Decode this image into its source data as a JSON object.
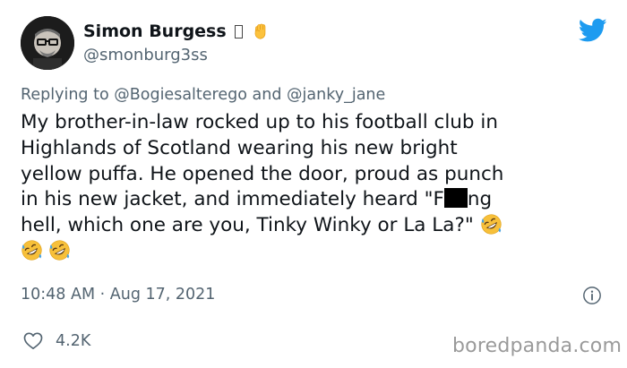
{
  "author": {
    "display_name": "Simon Burgess",
    "handle": "@smonburg3ss"
  },
  "reply": {
    "prefix": "Replying to",
    "mention_1": "@Bogiesalterego",
    "connector": "and",
    "mention_2": "@janky_jane"
  },
  "tweet": {
    "line_1": "My brother-in-law rocked up to his football club in",
    "line_2": "Highlands of Scotland wearing his new bright",
    "line_3": "yellow puffa. He opened the door, proud as punch",
    "line_4_before_redaction": "in his new jacket, and immediately heard \"F",
    "line_4_after_redaction": "ng",
    "line_5": "hell, which one are you, Tinky Winky or La La?\""
  },
  "meta": {
    "timestamp": "10:48 AM · Aug 17, 2021",
    "like_count": "4.2K"
  },
  "watermark": "boredpanda.com",
  "icons": {
    "bird": "twitter-bird-icon",
    "fist": "raised-fist-emoji-icon",
    "laugh": "rolling-on-floor-laughing-emoji-icon",
    "info": "info-icon",
    "heart": "heart-outline-icon"
  },
  "colors": {
    "twitter_blue": "#1d9bf0",
    "text_primary": "#0f1419",
    "text_secondary": "#536471"
  }
}
